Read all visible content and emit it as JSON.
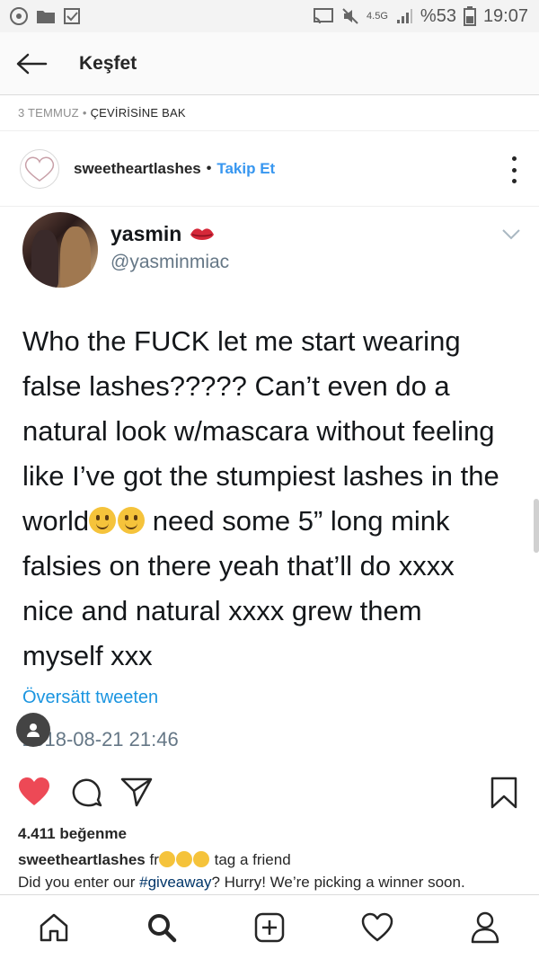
{
  "status_bar": {
    "signal": "4.5G",
    "battery": "%53",
    "time": "19:07"
  },
  "header": {
    "title": "Keşfet"
  },
  "meta": {
    "date": "3 TEMMUZ",
    "translate": "ÇEVİRİSİNE BAK"
  },
  "post": {
    "username": "sweetheartlashes",
    "follow_label": "Takip Et",
    "likes": "4.411 beğenme",
    "caption_user": "sweetheartlashes",
    "caption_start": "fr",
    "caption_rest": " tag a friend",
    "caption_line2_a": "Did you enter our ",
    "caption_hashtag": "#giveaway",
    "caption_line2_b": "? Hurry! We’re picking a winner soon."
  },
  "tweet": {
    "name": "yasmin",
    "handle": "@yasminmiac",
    "text_a": "Who the FUCK let me start wearing\nfalse lashes????? Can’t even do a\nnatural look w/mascara without feeling\nlike I’ve got the stumpiest lashes in the\nworld",
    "text_b": " need some 5” long mink\nfalsies on there yeah that’ll do xxxx\nnice and natural xxxx grew them\nmyself xxx",
    "translate": "Översätt tweeten",
    "date": "2018-08-21 21:46"
  },
  "icons": {
    "back": "back-arrow-icon",
    "more": "more-options-icon",
    "like": "heart-filled-icon",
    "comment": "comment-icon",
    "share": "share-icon",
    "save": "bookmark-icon",
    "nav_home": "home-icon",
    "nav_search": "search-icon",
    "nav_add": "add-icon",
    "nav_activity": "heart-icon",
    "nav_profile": "profile-icon"
  },
  "colors": {
    "like": "#ed4956",
    "link": "#3897f0",
    "tweet_link": "#1b95e0"
  }
}
